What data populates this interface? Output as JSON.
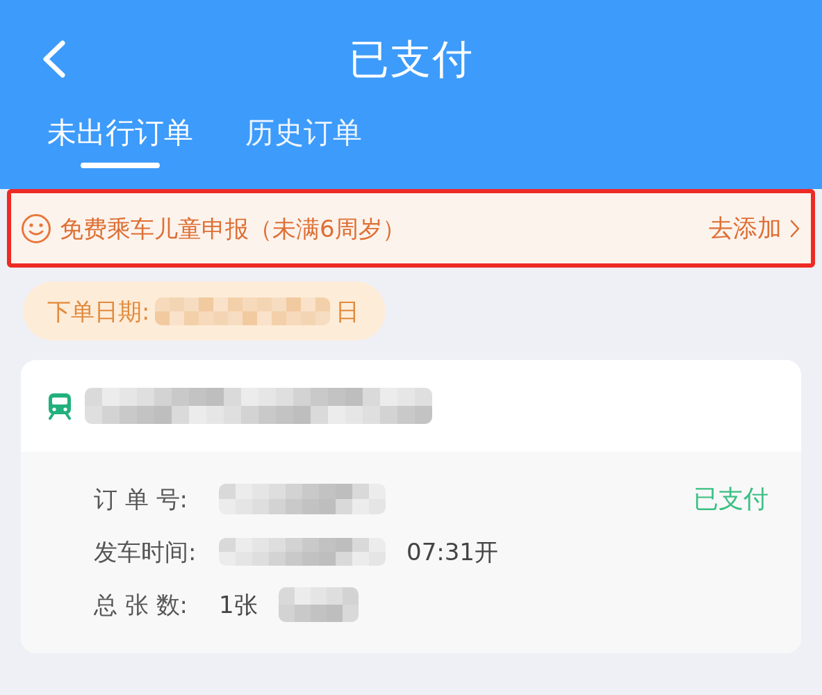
{
  "header": {
    "title": "已支付"
  },
  "tabs": [
    {
      "label": "未出行订单",
      "selected": true
    },
    {
      "label": "历史订单",
      "selected": false
    }
  ],
  "child_banner": {
    "text": "免费乘车儿童申报（未满6周岁）",
    "action": "去添加",
    "highlighted": true
  },
  "order_date": {
    "label": "下单日期:",
    "parts": [
      {
        "kind": "redacted"
      },
      {
        "kind": "text",
        "text": "日"
      }
    ]
  },
  "order_card": {
    "title_parts": [
      {
        "kind": "redacted"
      }
    ],
    "status": "已支付",
    "fields": [
      {
        "label": "订 单 号:",
        "parts": [
          {
            "kind": "redacted"
          }
        ]
      },
      {
        "label": "发车时间:",
        "parts": [
          {
            "kind": "redacted"
          },
          {
            "kind": "text",
            "text": "07:31开"
          }
        ]
      },
      {
        "label": "总 张 数:",
        "parts": [
          {
            "kind": "text",
            "text": "1张"
          },
          {
            "kind": "redacted"
          }
        ]
      }
    ]
  }
}
